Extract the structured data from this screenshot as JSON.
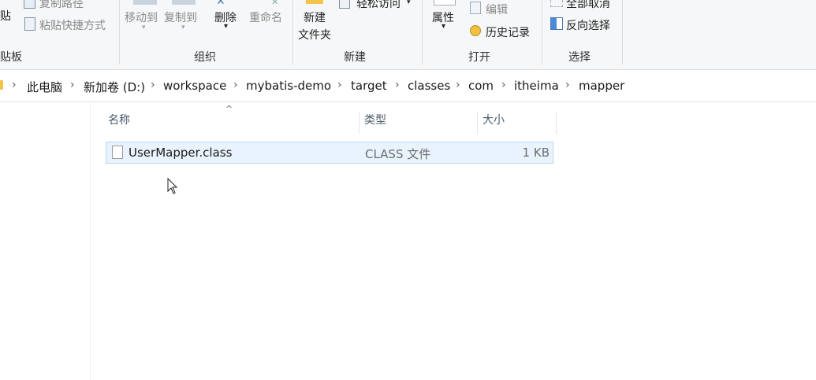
{
  "ribbon": {
    "clipboard": {
      "paste_label": "贴",
      "copy_path_label": "复制路径",
      "paste_shortcut_label": "粘贴快捷方式",
      "group_label": "贴板"
    },
    "organize": {
      "move_to_label": "移动到",
      "copy_to_label": "复制到",
      "delete_label": "删除",
      "rename_label": "重命名",
      "group_label": "组织"
    },
    "new": {
      "new_folder_line1": "新建",
      "new_folder_line2": "文件夹",
      "easy_access_label": "轻松访问",
      "group_label": "新建"
    },
    "open": {
      "properties_label": "属性",
      "edit_label": "编辑",
      "history_label": "历史记录",
      "group_label": "打开"
    },
    "select": {
      "select_none_label": "全部取消",
      "invert_selection_label": "反向选择",
      "group_label": "选择"
    }
  },
  "breadcrumb": [
    "此电脑",
    "新加卷 (D:)",
    "workspace",
    "mybatis-demo",
    "target",
    "classes",
    "com",
    "itheima",
    "mapper"
  ],
  "columns": {
    "name": "名称",
    "type": "类型",
    "size": "大小"
  },
  "files": [
    {
      "name": "UserMapper.class",
      "type": "CLASS 文件",
      "size": "1 KB"
    }
  ]
}
